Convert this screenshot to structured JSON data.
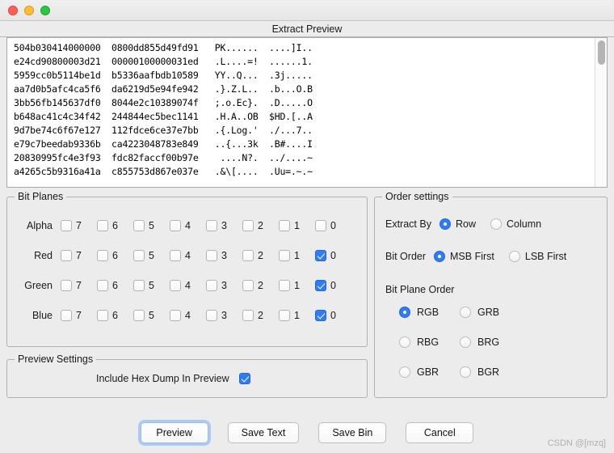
{
  "window": {
    "traffic_lights": [
      "close",
      "minimize",
      "maximize"
    ]
  },
  "preview": {
    "header_title": "Extract Preview",
    "hex_lines": [
      "504b030414000000  0800dd855d49fd91   PK......  ....]I..",
      "e24cd90800003d21  00000100000031ed   .L....=!  ......1.",
      "5959cc0b5114be1d  b5336aafbdb10589   YY..Q...  .3j.....",
      "aa7d0b5afc4ca5f6  da6219d5e94fe942   .}.Z.L..  .b...O.B",
      "3bb56fb145637df0  8044e2c10389074f   ;.o.Ec}.  .D.....O",
      "b648ac41c4c34f42  244844ec5bec1141   .H.A..OB  $HD.[..A",
      "9d7be74c6f67e127  112fdce6ce37e7bb   .{.Log.'  ./...7..",
      "e79c7beedab9336b  ca4223048783e849   ..{...3k  .B#....I",
      "20830995fc4e3f93  fdc82faccf00b97e    ....N?.  ../....~",
      "a4265c5b9316a41a  c855753d867e037e   .&\\[....  .Uu=.~.~"
    ]
  },
  "bit_planes": {
    "legend": "Bit Planes",
    "bit_labels": [
      "7",
      "6",
      "5",
      "4",
      "3",
      "2",
      "1",
      "0"
    ],
    "rows": [
      {
        "channel": "Alpha",
        "checked": [
          false,
          false,
          false,
          false,
          false,
          false,
          false,
          false
        ]
      },
      {
        "channel": "Red",
        "checked": [
          false,
          false,
          false,
          false,
          false,
          false,
          false,
          true
        ]
      },
      {
        "channel": "Green",
        "checked": [
          false,
          false,
          false,
          false,
          false,
          false,
          false,
          true
        ]
      },
      {
        "channel": "Blue",
        "checked": [
          false,
          false,
          false,
          false,
          false,
          false,
          false,
          true
        ]
      }
    ]
  },
  "order_settings": {
    "legend": "Order settings",
    "extract_by": {
      "label": "Extract By",
      "options": [
        "Row",
        "Column"
      ],
      "selected": "Row"
    },
    "bit_order": {
      "label": "Bit Order",
      "options": [
        "MSB First",
        "LSB First"
      ],
      "selected": "MSB First"
    },
    "bit_plane_order": {
      "label": "Bit Plane Order",
      "options": [
        "RGB",
        "GRB",
        "RBG",
        "BRG",
        "GBR",
        "BGR"
      ],
      "selected": "RGB"
    }
  },
  "preview_settings": {
    "legend": "Preview Settings",
    "include_hex_dump": {
      "label": "Include Hex Dump In Preview",
      "checked": true
    }
  },
  "buttons": [
    {
      "label": "Preview",
      "focused": true
    },
    {
      "label": "Save Text",
      "focused": false
    },
    {
      "label": "Save Bin",
      "focused": false
    },
    {
      "label": "Cancel",
      "focused": false
    }
  ],
  "watermark": "CSDN @[mzq]",
  "colors": {
    "accent": "#2f7cf6",
    "window_bg": "#ececec",
    "text_bg": "#ffffff",
    "border": "#b0b0b0"
  }
}
